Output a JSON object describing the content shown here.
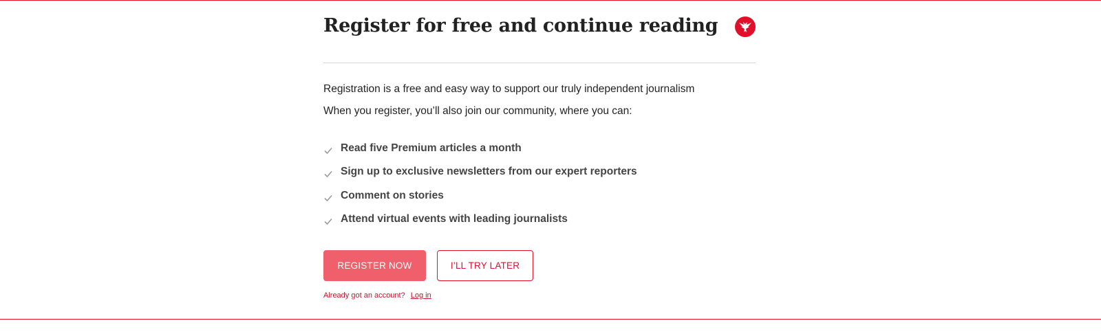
{
  "modal": {
    "title": "Register for free and continue reading",
    "logo_icon": "eagle-logo-icon",
    "intro_line_1": "Registration is a free and easy way to support our truly independent journalism",
    "intro_line_2": "When you register, you’ll also join our community, where you can:",
    "benefits": [
      {
        "label": "Read five Premium articles a month",
        "icon": "check-icon"
      },
      {
        "label": "Sign up to exclusive newsletters from our expert reporters",
        "icon": "check-icon"
      },
      {
        "label": "Comment on stories",
        "icon": "check-icon"
      },
      {
        "label": "Attend virtual events with leading journalists",
        "icon": "check-icon"
      }
    ],
    "register_button": "Register now",
    "later_button": "I’ll try later",
    "login_prompt": "Already got an account?",
    "login_link": "Log in"
  },
  "colors": {
    "brand_red": "#e0102a",
    "button_fill": "#ef5f6c",
    "text": "#222222",
    "divider": "#d6d6d6"
  }
}
